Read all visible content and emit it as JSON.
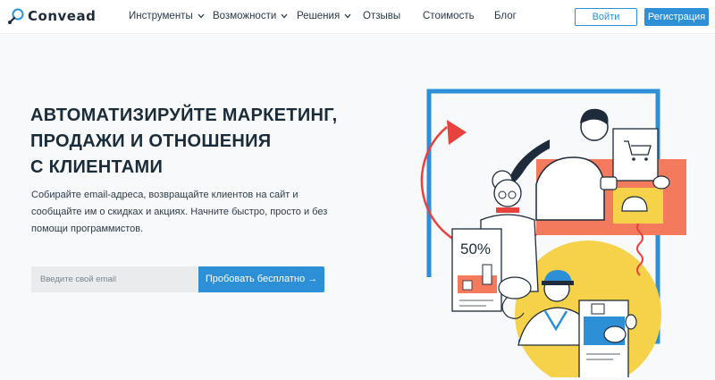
{
  "brand": {
    "name": "Convead"
  },
  "nav": {
    "items": [
      {
        "label": "Инструменты",
        "dropdown": true
      },
      {
        "label": "Возможности",
        "dropdown": true
      },
      {
        "label": "Решения",
        "dropdown": true
      },
      {
        "label": "Отзывы",
        "dropdown": false
      },
      {
        "label": "Стоимость",
        "dropdown": false
      },
      {
        "label": "Блог",
        "dropdown": false
      }
    ]
  },
  "auth": {
    "login_label": "Войти",
    "register_label": "Регистрация"
  },
  "hero": {
    "headline_lines": [
      "АВТОМАТИЗИРУЙТЕ МАРКЕТИНГ,",
      "ПРОДАЖИ И ОТНОШЕНИЯ",
      "С КЛИЕНТАМИ"
    ],
    "subtext_lines": [
      "Собирайте email-адреса, возвращайте клиентов на сайт и",
      "сообщайте им о скидках и акциях. Начните быстро, просто и без",
      "помощи программистов."
    ],
    "email_placeholder": "Введите свой email",
    "cta_label": "Пробовать бесплатно →"
  },
  "illustration": {
    "discount_text": "50%"
  },
  "colors": {
    "accent": "#2d8fd5",
    "coral": "#f47a5e",
    "yellow": "#f6d24a",
    "red": "#e8423f",
    "dark": "#1d2b3a"
  }
}
